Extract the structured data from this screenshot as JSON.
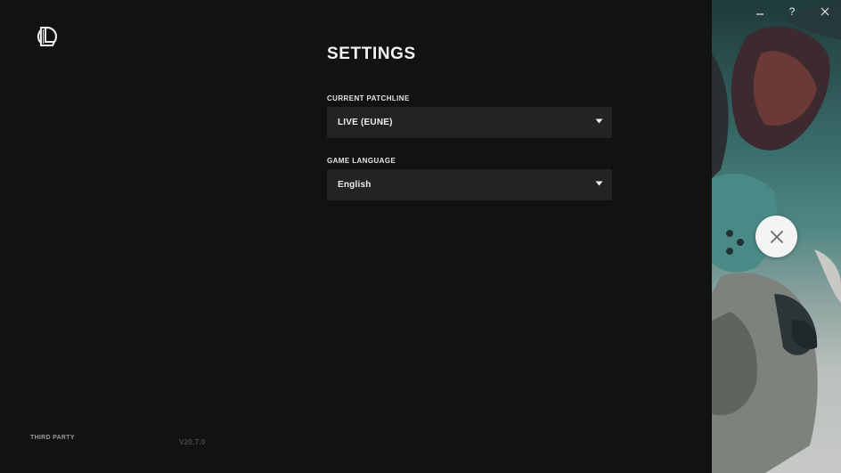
{
  "settings": {
    "title": "SETTINGS",
    "patchline": {
      "label": "CURRENT PATCHLINE",
      "value": "LIVE (EUNE)"
    },
    "language": {
      "label": "GAME LANGUAGE",
      "value": "English"
    }
  },
  "footer": {
    "third_party": "THIRD PARTY",
    "version": "V20.7.0"
  },
  "window_controls": {
    "help": "?"
  },
  "icons": {
    "logo": "league-logo-icon",
    "dropdown": "caret-down-icon",
    "close": "close-icon",
    "minimize": "minimize-icon"
  }
}
